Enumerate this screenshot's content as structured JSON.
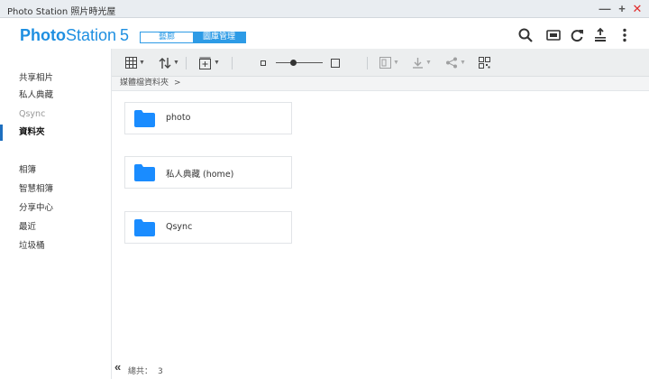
{
  "window": {
    "title": "Photo Station 照片時光屋",
    "controls": [
      "—",
      "+",
      "✕"
    ]
  },
  "header": {
    "logo_bold": "Photo",
    "logo_light": "Station",
    "logo_version": "5",
    "mode_tabs": [
      {
        "label": "藝廊",
        "selected": false
      },
      {
        "label": "圖庫管理",
        "selected": true
      }
    ],
    "icons": [
      "search-icon",
      "cast-icon",
      "refresh-icon",
      "upload-stack-icon",
      "more-icon"
    ],
    "accent_color": "#1e8fe1"
  },
  "sidebar": {
    "items": [
      {
        "label": "共享相片",
        "state": "normal"
      },
      {
        "label": "私人典藏",
        "state": "normal"
      },
      {
        "label": "Qsync",
        "state": "dim"
      },
      {
        "label": "資料夾",
        "state": "active"
      },
      {
        "label": "相簿",
        "state": "normal"
      },
      {
        "label": "智慧相簿",
        "state": "normal"
      },
      {
        "label": "分享中心",
        "state": "normal"
      },
      {
        "label": "最近",
        "state": "normal"
      },
      {
        "label": "垃圾桶",
        "state": "normal"
      }
    ]
  },
  "toolbar": {
    "icons": [
      "grid-view-icon",
      "sort-icon",
      "add-icon",
      "thumbnail-size-slider",
      "import-icon",
      "download-icon",
      "share-icon",
      "qrcode-icon"
    ]
  },
  "breadcrumb": {
    "path": "媒體檔資料夾",
    "separator": ">"
  },
  "folders": [
    {
      "name": "photo"
    },
    {
      "name": "私人典藏 (home)"
    },
    {
      "name": "Qsync"
    }
  ],
  "folder_color": "#1a8cff",
  "footer": {
    "collapse_glyph": "«",
    "total_label": "總共：",
    "total_count": "3"
  }
}
